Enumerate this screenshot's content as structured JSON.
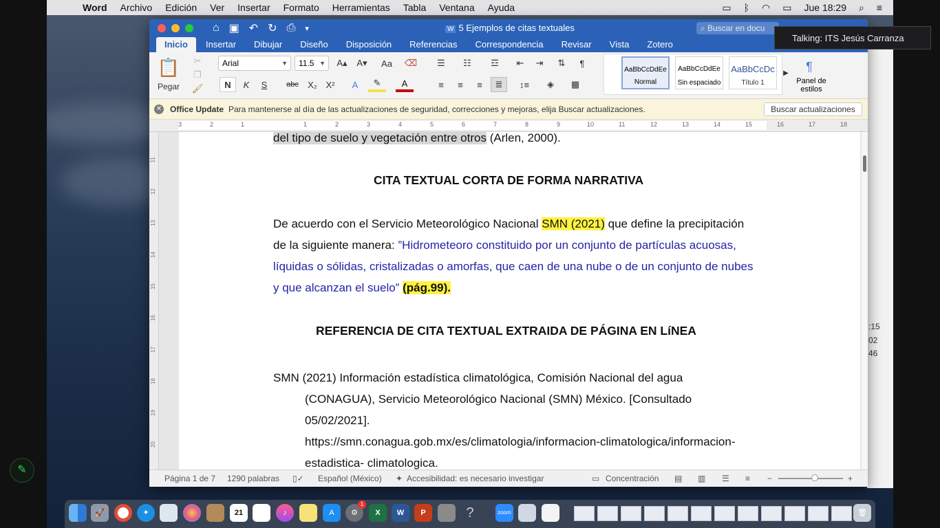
{
  "menubar": {
    "app_name": "Word",
    "items": [
      "Archivo",
      "Edición",
      "Ver",
      "Insertar",
      "Formato",
      "Herramientas",
      "Tabla",
      "Ventana",
      "Ayuda"
    ],
    "clock": "Jue 18:29"
  },
  "window": {
    "title": "5 Ejemplos de citas textuales",
    "search_placeholder": "Buscar en docu",
    "tabs": [
      "Inicio",
      "Insertar",
      "Dibujar",
      "Diseño",
      "Disposición",
      "Referencias",
      "Correspondencia",
      "Revisar",
      "Vista",
      "Zotero"
    ]
  },
  "ribbon": {
    "paste_label": "Pegar",
    "font_name": "Arial",
    "font_size": "11.5",
    "bold": "N",
    "italic": "K",
    "underline": "S",
    "strike": "abc",
    "styles": [
      {
        "sample": "AaBbCcDdEe",
        "name": "Normal"
      },
      {
        "sample": "AaBbCcDdEe",
        "name": "Sin espaciado"
      },
      {
        "sample": "AaBbCcDc",
        "name": "Título 1"
      }
    ],
    "styles_panel_label_line1": "Panel de",
    "styles_panel_label_line2": "estilos"
  },
  "update_bar": {
    "title": "Office Update",
    "message": "Para mantenerse al día de las actualizaciones de seguridad, correcciones y mejoras, elija Buscar actualizaciones.",
    "button": "Buscar actualizaciones"
  },
  "ruler": {
    "numbers": [
      "3",
      "2",
      "1",
      "1",
      "2",
      "3",
      "4",
      "5",
      "6",
      "7",
      "8",
      "9",
      "10",
      "11",
      "12",
      "13",
      "14",
      "15",
      "16",
      "17",
      "18"
    ],
    "vnumbers": [
      "11",
      "12",
      "13",
      "14",
      "15",
      "16",
      "17",
      "18",
      "19",
      "20"
    ]
  },
  "document": {
    "line_top": "del tipo de suelo y vegetación entre otros",
    "line_top_tail": " (Arlen, 2000).",
    "heading1": "CITA TEXTUAL CORTA DE FORMA NARRATIVA",
    "p1_a": "De acuerdo con el Servicio Meteorológico Nacional ",
    "p1_hl": "SMN (2021)",
    "p1_b": " que define la precipitación",
    "p2_a": "de la siguiente manera: ",
    "p2_quote": "”Hidrometeoro constituido por un conjunto de partículas acuosas,",
    "p3": "líquidas o sólidas, cristalizadas o amorfas, que caen de una nube o de un conjunto de nubes",
    "p4": "y que alcanzan el suelo”",
    "p4_hl": "(pág.99).",
    "heading2": "REFERENCIA DE CITA TEXTUAL EXTRAIDA DE PÁGINA EN LíNEA",
    "ref_line1": "SMN (2021) Información estadística climatológica, Comisión Nacional del agua",
    "ref_line2": "(CONAGUA), Servicio Meteorológico Nacional (SMN) México. [Consultado",
    "ref_line3": "05/02/2021].",
    "ref_line4": "https://smn.conagua.gob.mx/es/climatologia/informacion-climatologica/informacion-",
    "ref_line5": "estadistica- climatologica."
  },
  "status_bar": {
    "page": "Página 1 de 7",
    "words": "1290 palabras",
    "language": "Español (México)",
    "accessibility": "Accesibilidad: es necesario investigar",
    "focus": "Concentración",
    "zoom_minus": "−",
    "zoom_plus": "+"
  },
  "notification": {
    "text": "Talking: ITS Jesús Carranza"
  },
  "behind_window": {
    "numbers": [
      ":15",
      "02",
      "46"
    ]
  },
  "dock": {
    "items": [
      "Finder",
      "Launchpad",
      "Chrome",
      "Safari",
      "Vista previa",
      "Fotos",
      "Contactos",
      "Calendario",
      "Recordatorios",
      "iTunes",
      "Notas",
      "App Store",
      "Preferencias",
      "Excel",
      "Word",
      "PowerPoint",
      "Calculadora",
      "Ayuda",
      "Zoom",
      "Escáner",
      "Documento"
    ],
    "calendar_day": "21",
    "notification_badge": "1",
    "zoom_label": "zoom"
  },
  "colors": {
    "word_blue": "#2b62b7",
    "highlight_yellow": "#fff241",
    "quote_blue": "#2424a8"
  }
}
